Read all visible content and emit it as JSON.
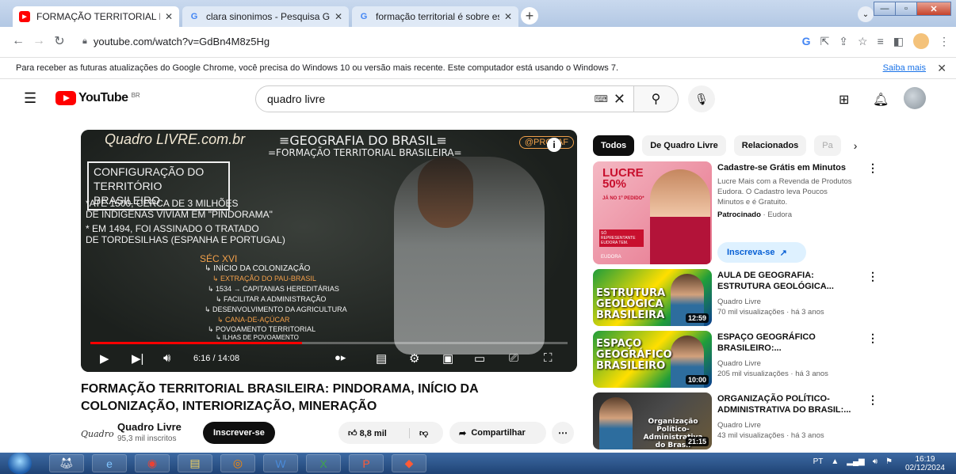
{
  "browser": {
    "tabs": [
      {
        "title": "FORMAÇÃO TERRITORIAL BRASIL",
        "icon": "youtube-icon",
        "color": "#ff0000"
      },
      {
        "title": "clara sinonimos - Pesquisa Goog",
        "icon": "google-icon",
        "color": "#4285f4"
      },
      {
        "title": "formação territorial é sobre espa",
        "icon": "google-icon",
        "color": "#4285f4"
      }
    ],
    "new_tab": "+",
    "url": "youtube.com/watch?v=GdBn4M8z5Hg",
    "info_bar": {
      "message": "Para receber as futuras atualizações do Google Chrome, você precisa do Windows 10 ou versão mais recente. Este computador está usando o Windows 7.",
      "link": "Saiba mais"
    }
  },
  "youtube": {
    "logo_text": "YouTube",
    "region": "BR",
    "search_value": "quadro livre",
    "video": {
      "board": {
        "brand": "Quadro LIVRE.com.br",
        "title_line1": "≡GEOGRAFIA DO BRASIL≡",
        "title_line2": "=FORMAÇÃO TERRITORIAL BRASILEIRA=",
        "box": "CONFIGURAÇÃO DO TERRITÓRIO BRASILEIRO",
        "notes": [
          "*ATÉ 1500, CERCA DE 3 MILHÕES",
          "DE INDÍGENAS VIVIAM EM \"PINDORAMA\"",
          "* EM 1494, FOI ASSINADO O TRATADO",
          "DE TORDESILHAS (ESPANHA E PORTUGAL)",
          "SÉC XVI",
          "↳ INÍCIO DA COLONIZAÇÃO",
          "↳ EXTRAÇÃO DO PAU-BRASIL",
          "↳ 1534 → CAPITANIAS HEREDITÁRIAS",
          "↳ FACILITAR A ADMINISTRAÇÃO",
          "↳ DESENVOLVIMENTO DA AGRICULTURA",
          "↳ CANA-DE-AÇÚCAR",
          "↳ POVOAMENTO TERRITORIAL",
          "↳ ILHAS DE POVOAMENTO"
        ],
        "handle": "@PROFAF"
      },
      "time_current": "6:16",
      "time_total": "14:08",
      "progress": 0.444,
      "title": "FORMAÇÃO TERRITORIAL BRASILEIRA: PINDORAMA, INÍCIO DA COLONIZAÇÃO, INTERIORIZAÇÃO, MINERAÇÃO",
      "channel": {
        "name": "Quadro Livre",
        "subs": "95,3 mil inscritos",
        "logo_text": "Quadro"
      },
      "subscribe_label": "Inscrever-se",
      "likes": "8,8 mil",
      "share_label": "Compartilhar"
    },
    "chips": [
      "Todos",
      "De Quadro Livre",
      "Relacionados",
      "Pa"
    ],
    "ad": {
      "thumb_big": "LUCRE 50%",
      "thumb_small": "JÁ NO 1º PEDIDO*",
      "thumb_tag": "SÓ REPRESENTANTE EUDORA TEM.",
      "thumb_brand": "EUDORA",
      "title": "Cadastre-se Grátis em Minutos",
      "desc": "Lucre Mais com a Revenda de Produtos Eudora. O Cadastro leva Poucos Minutos e é Gratuito.",
      "sponsored": "Patrocinado",
      "advertiser": "· Eudora",
      "cta": "Inscreva-se"
    },
    "related": [
      {
        "title": "AULA DE GEOGRAFIA: ESTRUTURA GEOLÓGICA...",
        "channel": "Quadro Livre",
        "meta": "70 mil visualizações · há 3 anos",
        "duration": "12:59",
        "thumb_text": "ESTRUTURA GEOLÓGICA BRASILEIRA"
      },
      {
        "title": "ESPAÇO GEOGRÁFICO BRASILEIRO:...",
        "channel": "Quadro Livre",
        "meta": "205 mil visualizações · há 3 anos",
        "duration": "10:00",
        "thumb_text": "ESPAÇO GEOGRÁFICO BRASILEIRO"
      },
      {
        "title": "ORGANIZAÇÃO POLÍTICO-ADMINISTRATIVA DO BRASIL:...",
        "channel": "Quadro Livre",
        "meta": "43 mil visualizações · há 3 anos",
        "duration": "21:15",
        "thumb_text": "Organização Político-Administrativa do Brasil"
      }
    ]
  },
  "taskbar": {
    "lang": "PT",
    "time": "16:19",
    "date": "02/12/2024"
  }
}
